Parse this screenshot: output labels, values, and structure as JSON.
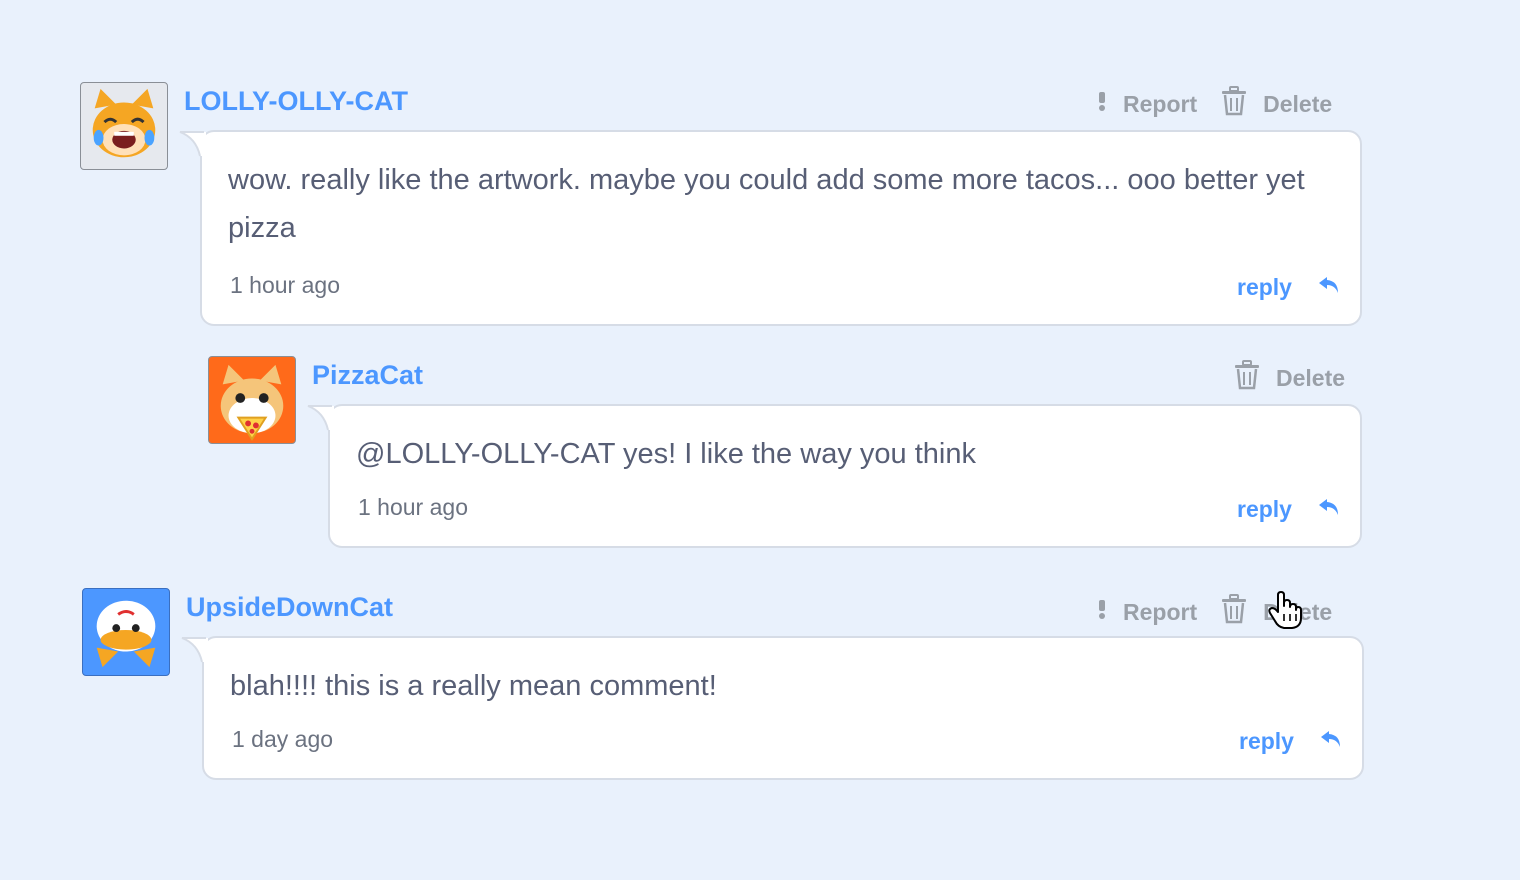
{
  "comments": [
    {
      "username": "LOLLY-OLLY-CAT",
      "text": "wow. really like the artwork. maybe you could add some more tacos... ooo better yet pizza",
      "timestamp": "1 hour ago",
      "report_label": "Report",
      "delete_label": "Delete",
      "reply_label": "reply",
      "avatar_icon": "laughing-cat-icon"
    },
    {
      "username": "PizzaCat",
      "text": "@LOLLY-OLLY-CAT yes! I like the way you think",
      "timestamp": "1 hour ago",
      "delete_label": "Delete",
      "reply_label": "reply",
      "avatar_icon": "pizza-cat-icon"
    },
    {
      "username": "UpsideDownCat",
      "text": "blah!!!! this is a really mean comment!",
      "timestamp": "1 day ago",
      "report_label": "Report",
      "delete_label": "Delete",
      "reply_label": "reply",
      "avatar_icon": "upside-down-cat-icon"
    }
  ],
  "colors": {
    "accent": "#4c97ff",
    "background": "#e9f1fc",
    "muted": "#9aa0a8",
    "text": "#575e75"
  }
}
